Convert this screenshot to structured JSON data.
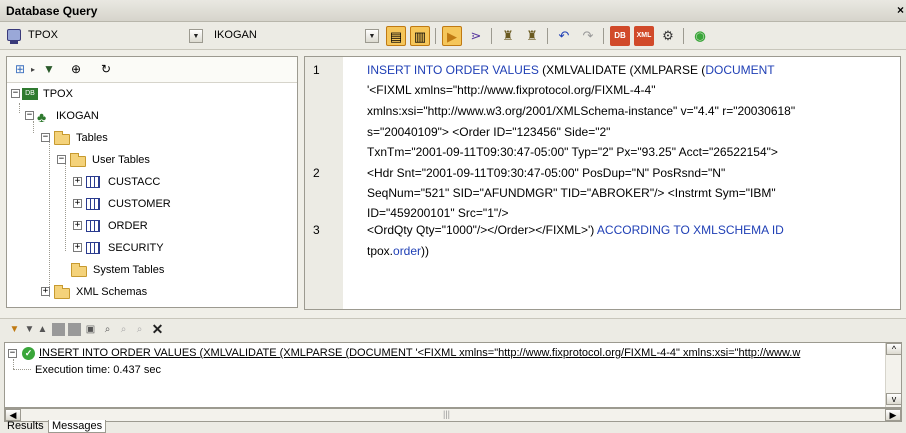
{
  "window": {
    "title": "Database Query",
    "close": "×"
  },
  "connection": {
    "database": "TPOX",
    "schema": "IKOGAN"
  },
  "tree": {
    "nodes": [
      {
        "label": "TPOX",
        "expander": "−"
      },
      {
        "label": "IKOGAN",
        "expander": "−"
      },
      {
        "label": "Tables",
        "expander": "−"
      },
      {
        "label": "User Tables",
        "expander": "−"
      },
      {
        "label": "CUSTACC",
        "expander": "+"
      },
      {
        "label": "CUSTOMER",
        "expander": "+"
      },
      {
        "label": "ORDER",
        "expander": "+"
      },
      {
        "label": "SECURITY",
        "expander": "+"
      },
      {
        "label": "System Tables",
        "expander": ""
      },
      {
        "label": "XML Schemas",
        "expander": "+"
      }
    ]
  },
  "editor": {
    "line_numbers": [
      "1",
      "2",
      "3"
    ],
    "lines": [
      {
        "pre": "",
        "kw": "INSERT INTO ORDER VALUES",
        "mid": " (XMLVALIDATE (XMLPARSE (",
        "kw2": "DOCUMENT",
        "post": ""
      },
      {
        "pre": "'<FIXML xmlns=\"http://www.fixprotocol.org/FIXML-4-4\"",
        "kw": "",
        "mid": "",
        "kw2": "",
        "post": ""
      },
      {
        "pre": "xmlns:xsi=\"http://www.w3.org/2001/XMLSchema-instance\" v=\"4.4\" r=\"20030618\"",
        "kw": "",
        "mid": "",
        "kw2": "",
        "post": ""
      },
      {
        "pre": "s=\"20040109\"> <Order ID=\"123456\" Side=\"2\"",
        "kw": "",
        "mid": "",
        "kw2": "",
        "post": ""
      },
      {
        "pre": "TxnTm=\"2001-09-11T09:30:47-05:00\" Typ=\"2\" Px=\"93.25\" Acct=\"26522154\">",
        "kw": "",
        "mid": "",
        "kw2": "",
        "post": ""
      },
      {
        "pre": "<Hdr Snt=\"2001-09-11T09:30:47-05:00\" PosDup=\"N\" PosRsnd=\"N\"",
        "kw": "",
        "mid": "",
        "kw2": "",
        "post": ""
      },
      {
        "pre": "SeqNum=\"521\" SID=\"AFUNDMGR\" TID=\"ABROKER\"/> <Instrmt Sym=\"IBM\"",
        "kw": "",
        "mid": "",
        "kw2": "",
        "post": ""
      },
      {
        "pre": "ID=\"459200101\" Src=\"1\"/>",
        "kw": "",
        "mid": "",
        "kw2": "",
        "post": ""
      },
      {
        "pre": "<OrdQty Qty=\"1000\"/></Order></FIXML>')",
        "kw": " ACCORDING TO XMLSCHEMA ID",
        "mid": "",
        "kw2": "",
        "post": ""
      },
      {
        "pre": "tpox.",
        "kw": "order",
        "mid": "))",
        "kw2": "",
        "post": ""
      }
    ]
  },
  "messages": {
    "query": "INSERT INTO ORDER VALUES (XMLVALIDATE (XMLPARSE (DOCUMENT '<FIXML xmlns=\"http://www.fixprotocol.org/FIXML-4-4\" xmlns:xsi=\"http://www.w",
    "exec_time": "Execution time: 0.437 sec"
  },
  "tabs": {
    "results": "Results",
    "messages": "Messages"
  },
  "colors": {
    "keyword": "#1f3fb5",
    "pressed": "#f5c65a",
    "success": "#3aa63a"
  }
}
